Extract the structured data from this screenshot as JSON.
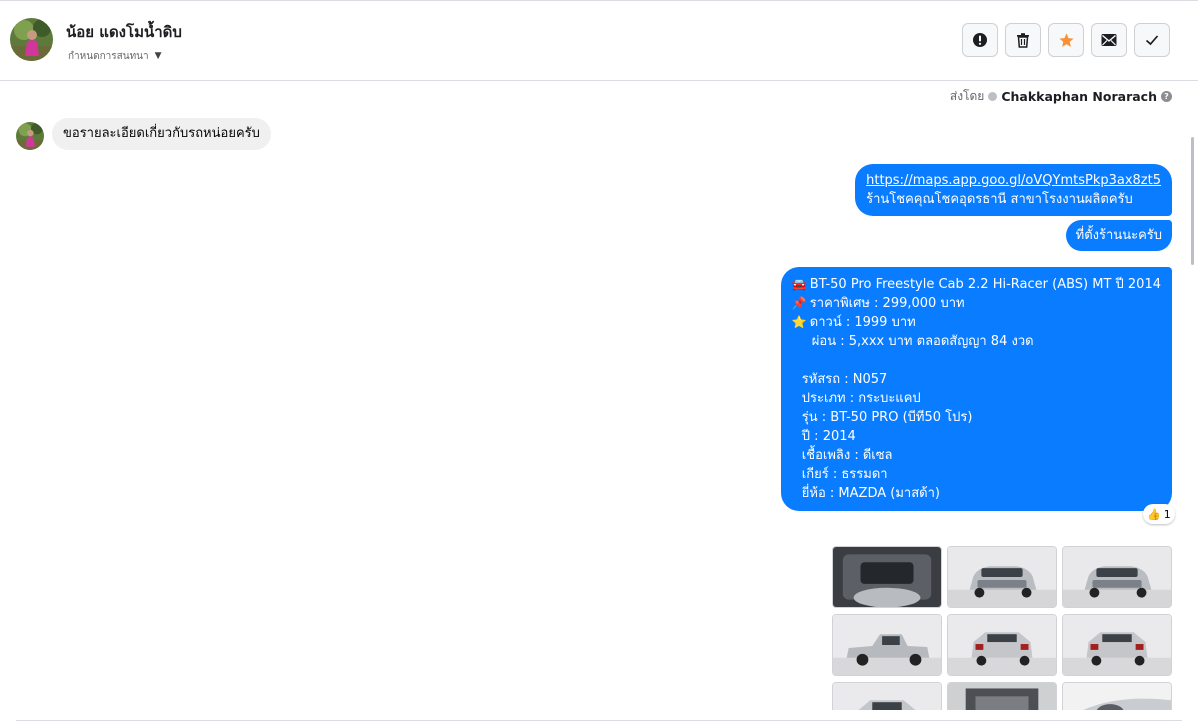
{
  "header": {
    "contact_name": "น้อย แดงโมน้ำดิบ",
    "label_text": "กำหนดการสนทนา",
    "actions": [
      {
        "name": "report-button",
        "icon": "alert-circle-icon"
      },
      {
        "name": "delete-button",
        "icon": "trash-icon"
      },
      {
        "name": "star-button",
        "icon": "star-icon",
        "color": "#f7923b"
      },
      {
        "name": "mark-unread-button",
        "icon": "envelope-icon"
      },
      {
        "name": "mark-done-button",
        "icon": "check-icon"
      }
    ]
  },
  "sent_by": {
    "prefix": "ส่งโดย",
    "name": "Chakkaphan Norarach",
    "help": "?"
  },
  "messages": {
    "incoming_1": "ขอรายละเอียดเกี่ยวกับรถหน่อยครับ",
    "outgoing_1": {
      "link": "https://maps.app.goo.gl/oVQYmtsPkp3ax8zt5",
      "text": "ร้านโชคคุณโชคอุดรธานี สาขาโรงงานผลิตครับ"
    },
    "outgoing_2": "ที่ตั้งร้านนะครับ",
    "outgoing_3": {
      "title": "BT-50 Pro Freestyle Cab 2.2 Hi-Racer (ABS) MT ปี 2014",
      "price": "ราคาพิเศษ : 299,000 บาท",
      "down": "ดาวน์ : 1999 บาท",
      "installment": "ผ่อน : 5,xxx บาท ตลอดสัญญา 84 งวด",
      "code": "รหัสรถ : N057",
      "type": "ประเภท : กระบะแคป",
      "model": "รุ่น : BT-50 PRO (บีที50 โปร)",
      "year": "ปี : 2014",
      "fuel": "เชื้อเพลิง : ดีเซล",
      "gear": "เกียร์ : ธรรมดา",
      "brand": "ยี่ห้อ : MAZDA (มาสด้า)",
      "emoji_title": "🚘",
      "emoji_price": "📌",
      "emoji_down": "⭐"
    },
    "reaction": {
      "emoji": "👍",
      "count": "1"
    }
  },
  "photos": [
    {
      "name": "photo-engine-bay",
      "kind": "engine"
    },
    {
      "name": "photo-front-left",
      "kind": "front"
    },
    {
      "name": "photo-front",
      "kind": "front"
    },
    {
      "name": "photo-side-left",
      "kind": "side"
    },
    {
      "name": "photo-rear-left",
      "kind": "rear"
    },
    {
      "name": "photo-rear",
      "kind": "rear"
    },
    {
      "name": "photo-rear-tailgate",
      "kind": "rear"
    },
    {
      "name": "photo-interior-bed",
      "kind": "dark"
    },
    {
      "name": "photo-closeup",
      "kind": "closeup"
    }
  ],
  "colors": {
    "outgoing_bubble": "#0a7cff",
    "incoming_bubble": "#f0f0f0",
    "star": "#f7923b"
  }
}
